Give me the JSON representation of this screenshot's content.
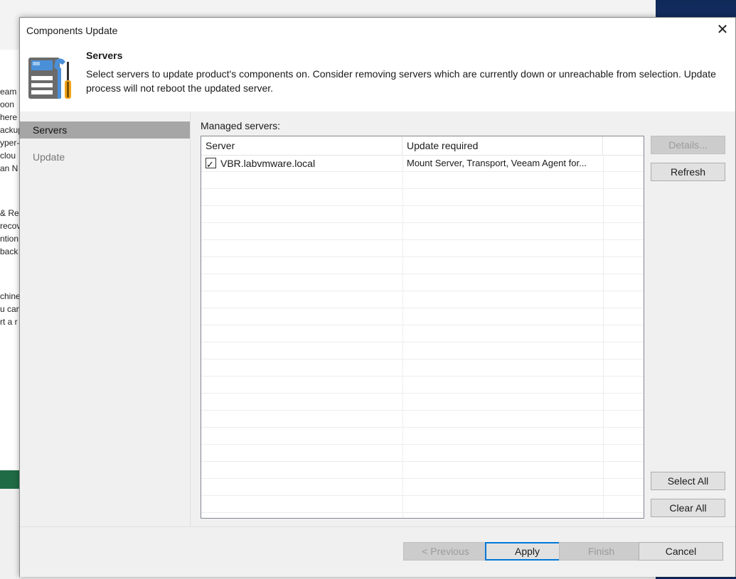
{
  "background": {
    "fragments": [
      "eam",
      "oon",
      "here",
      "ackup",
      "yper-",
      "clou",
      "an N",
      "& Rep",
      "recov",
      "ntion",
      "back",
      "chine",
      "u can",
      "rt a r"
    ]
  },
  "dialog": {
    "title": "Components Update",
    "close_glyph": "✕"
  },
  "header": {
    "title": "Servers",
    "description": "Select servers to update product's components on. Consider removing servers which are currently down or unreachable from selection. Update process will not reboot the updated server."
  },
  "sidebar": {
    "items": [
      {
        "label": "Servers",
        "active": true
      },
      {
        "label": "Update",
        "active": false
      }
    ]
  },
  "content": {
    "managed_label": "Managed servers:",
    "columns": [
      "Server",
      "Update required"
    ],
    "rows": [
      {
        "server": "VBR.labvmware.local",
        "update": "Mount Server, Transport, Veeam Agent for...",
        "checked": true
      }
    ]
  },
  "side_buttons": {
    "details": "Details...",
    "refresh": "Refresh",
    "select_all": "Select All",
    "clear_all": "Clear All"
  },
  "footer": {
    "previous": "< Previous",
    "apply": "Apply",
    "finish": "Finish",
    "cancel": "Cancel"
  }
}
